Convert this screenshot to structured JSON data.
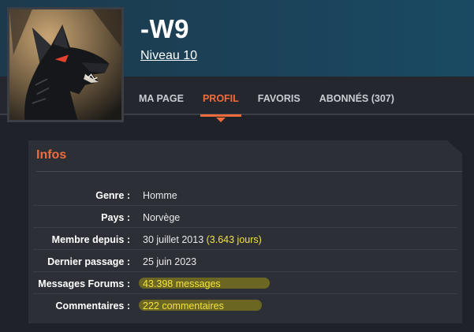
{
  "profile": {
    "username": "-W9",
    "level": "Niveau 10"
  },
  "tabs": [
    {
      "label": "MA PAGE",
      "active": false
    },
    {
      "label": "PROFIL",
      "active": true
    },
    {
      "label": "FAVORIS",
      "active": false
    },
    {
      "label": "ABONNÉS (307)",
      "active": false
    }
  ],
  "infos": {
    "title": "Infos",
    "rows": [
      {
        "label": "Genre :",
        "value": "Homme",
        "extra": ""
      },
      {
        "label": "Pays :",
        "value": "Norvège",
        "extra": ""
      },
      {
        "label": "Membre depuis :",
        "value": "30 juillet 2013",
        "extra": "(3.643 jours)"
      },
      {
        "label": "Dernier passage :",
        "value": "25 juin 2023",
        "extra": ""
      },
      {
        "label": "Messages Forums :",
        "value": "43.398 messages",
        "extra": ""
      },
      {
        "label": "Commentaires :",
        "value": "222 commentaires",
        "extra": ""
      }
    ]
  },
  "colors": {
    "accent": "#f26b3a",
    "highlight": "#f3e23a",
    "banner": "#1b4259",
    "card": "#2c2f35"
  },
  "icons": {
    "avatar": "wolf-avatar-icon"
  }
}
